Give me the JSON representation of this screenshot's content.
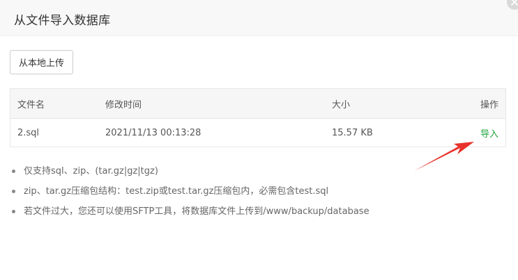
{
  "dialog": {
    "title": "从文件导入数据库",
    "close_icon": "close-icon"
  },
  "toolbar": {
    "upload_label": "从本地上传"
  },
  "table": {
    "headers": [
      "文件名",
      "修改时间",
      "大小",
      "操作"
    ],
    "rows": [
      {
        "name": "2.sql",
        "mtime": "2021/11/13 00:13:28",
        "size": "15.57 KB",
        "action": "导入"
      }
    ]
  },
  "notes": [
    "仅支持sql、zip、(tar.gz|gz|tgz)",
    "zip、tar.gz压缩包结构：test.zip或test.tar.gz压缩包内，必需包含test.sql",
    "若文件过大，您还可以使用SFTP工具，将数据库文件上传到/www/backup/database"
  ],
  "colors": {
    "accent": "#20a53a",
    "annotation_arrow": "#e8322b"
  }
}
